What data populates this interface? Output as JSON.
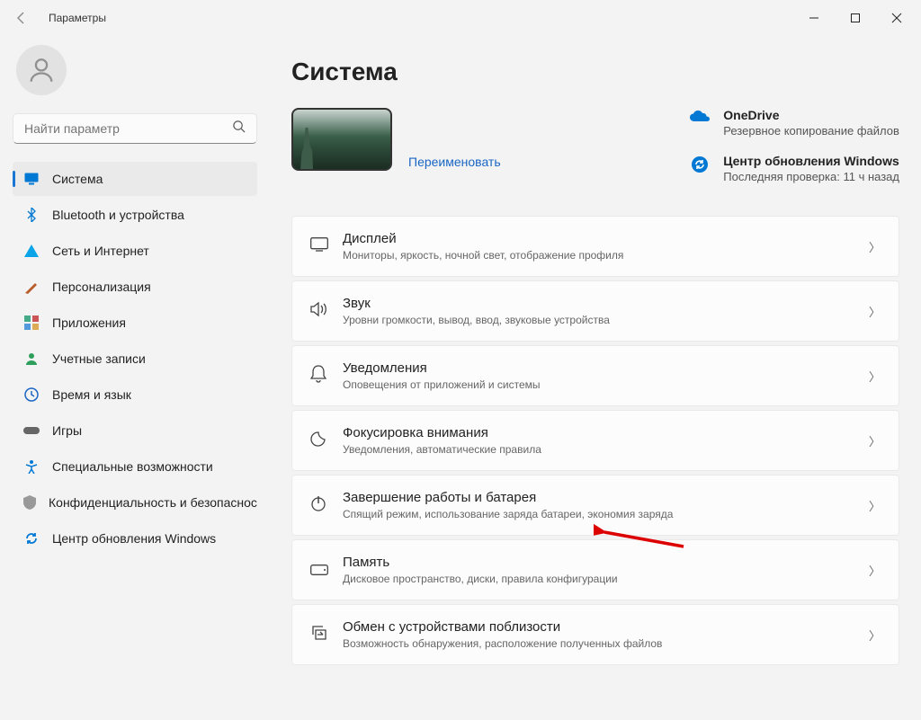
{
  "titlebar": {
    "title": "Параметры"
  },
  "search": {
    "placeholder": "Найти параметр"
  },
  "nav": {
    "system": "Система",
    "bluetooth": "Bluetooth и устройства",
    "network": "Сеть и Интернет",
    "personalization": "Персонализация",
    "apps": "Приложения",
    "accounts": "Учетные записи",
    "time": "Время и язык",
    "games": "Игры",
    "accessibility": "Специальные возможности",
    "privacy": "Конфиденциальность и безопасность",
    "update": "Центр обновления Windows"
  },
  "page": {
    "title": "Система",
    "rename": "Переименовать"
  },
  "status": {
    "onedrive": {
      "title": "OneDrive",
      "sub": "Резервное копирование файлов"
    },
    "update": {
      "title": "Центр обновления Windows",
      "sub": "Последняя проверка: 11 ч назад"
    }
  },
  "cards": {
    "display": {
      "title": "Дисплей",
      "sub": "Мониторы, яркость, ночной свет, отображение профиля"
    },
    "sound": {
      "title": "Звук",
      "sub": "Уровни громкости, вывод, ввод, звуковые устройства"
    },
    "notifications": {
      "title": "Уведомления",
      "sub": "Оповещения от приложений и системы"
    },
    "focus": {
      "title": "Фокусировка внимания",
      "sub": "Уведомления, автоматические правила"
    },
    "power": {
      "title": "Завершение работы и батарея",
      "sub": "Спящий режим, использование заряда батареи, экономия заряда"
    },
    "storage": {
      "title": "Память",
      "sub": "Дисковое пространство, диски, правила конфигурации"
    },
    "nearby": {
      "title": "Обмен с устройствами поблизости",
      "sub": "Возможность обнаружения, расположение полученных файлов"
    }
  }
}
